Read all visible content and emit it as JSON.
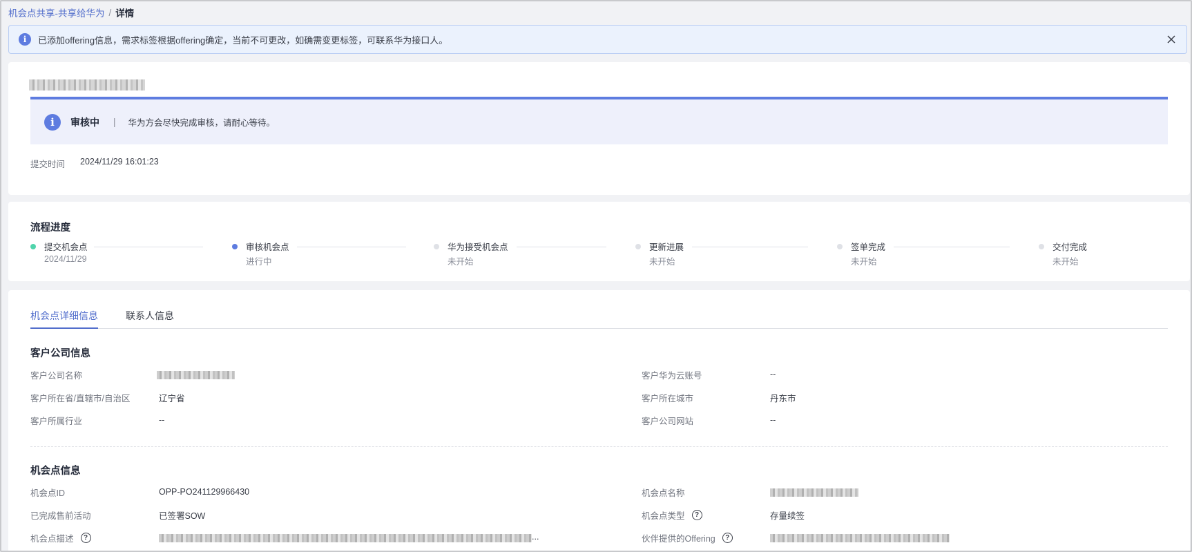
{
  "breadcrumb": {
    "parent": "机会点共享-共享给华为",
    "separator": "/",
    "current": "详情"
  },
  "alert": {
    "message": "已添加offering信息，需求标签根据offering确定，当前不可更改，如确需变更标签，可联系华为接口人。",
    "icon": "info-icon",
    "close_icon": "close-icon"
  },
  "status": {
    "label": "审核中",
    "divider": "|",
    "message": "华为方会尽快完成审核，请耐心等待。",
    "submit_label": "提交时间",
    "submit_time": "2024/11/29 16:01:23"
  },
  "progress": {
    "title": "流程进度",
    "steps": [
      {
        "title": "提交机会点",
        "sub": "2024/11/29",
        "state": "done",
        "color": "#50d4ab"
      },
      {
        "title": "审核机会点",
        "sub": "进行中",
        "state": "current",
        "color": "#5e7ce0"
      },
      {
        "title": "华为接受机会点",
        "sub": "未开始",
        "state": "pending",
        "color": "#dfe1e6"
      },
      {
        "title": "更新进展",
        "sub": "未开始",
        "state": "pending",
        "color": "#dfe1e6"
      },
      {
        "title": "签单完成",
        "sub": "未开始",
        "state": "pending",
        "color": "#dfe1e6"
      },
      {
        "title": "交付完成",
        "sub": "未开始",
        "state": "pending",
        "color": "#dfe1e6"
      }
    ]
  },
  "tabs": [
    {
      "label": "机会点详细信息",
      "active": true
    },
    {
      "label": "联系人信息",
      "active": false
    }
  ],
  "customer": {
    "title": "客户公司信息",
    "company_name_label": "客户公司名称",
    "cloud_account_label": "客户华为云账号",
    "cloud_account_value": "--",
    "province_label": "客户所在省/直辖市/自治区",
    "province_value": "辽宁省",
    "city_label": "客户所在城市",
    "city_value": "丹东市",
    "industry_label": "客户所属行业",
    "industry_value": "--",
    "website_label": "客户公司网站",
    "website_value": "--"
  },
  "opportunity": {
    "title": "机会点信息",
    "id_label": "机会点ID",
    "id_value": "OPP-PO241129966430",
    "name_label": "机会点名称",
    "presales_label": "已完成售前活动",
    "presales_value": "已签署SOW",
    "type_label": "机会点类型",
    "type_value": "存量续签",
    "desc_label": "机会点描述",
    "desc_suffix": "...",
    "offering_label": "伙伴提供的Offering"
  },
  "colors": {
    "accent": "#5e7ce0",
    "link": "#526ecc",
    "done": "#50d4ab"
  }
}
